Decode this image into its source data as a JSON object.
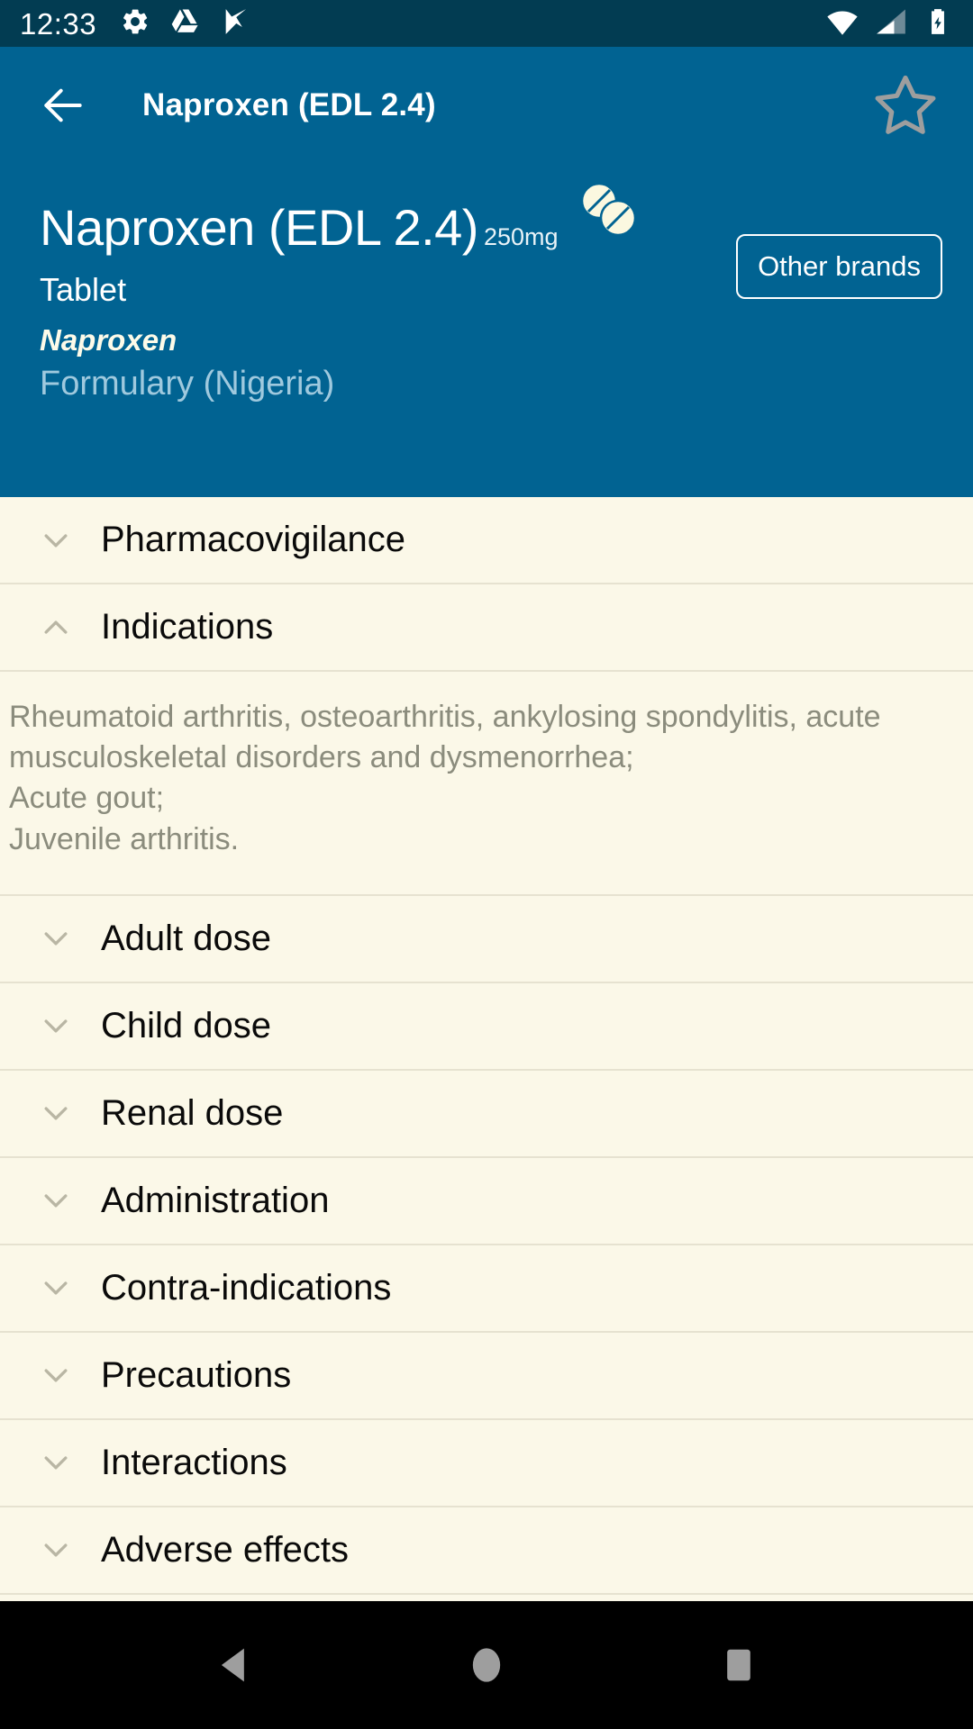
{
  "statusbar": {
    "time": "12:33",
    "left_icons": [
      "gear-icon",
      "google-drive-icon",
      "tasks-check-icon"
    ],
    "right_icons": [
      "wifi-icon",
      "cellular-signal-icon",
      "battery-charging-icon"
    ],
    "background_color": "#023c52"
  },
  "appbar": {
    "back_label": "back-arrow",
    "title": "Naproxen (EDL 2.4)",
    "favorite_label": "star-outline",
    "background_color": "#016392",
    "star_color": "#9e9e9e"
  },
  "drug_header": {
    "name": "Naproxen (EDL 2.4)",
    "strength": "250mg",
    "form": "Tablet",
    "generic": "Naproxen",
    "formulary": "Formulary (Nigeria)",
    "other_brands_label": "Other brands",
    "pill_icon": "two-tablets-icon",
    "pill_color": "#fbf8e0"
  },
  "sections": [
    {
      "label": "Pharmacovigilance",
      "expanded": false,
      "chevron": "chevron-down-icon",
      "body": ""
    },
    {
      "label": "Indications",
      "expanded": true,
      "chevron": "chevron-up-icon",
      "body": "Rheumatoid arthritis, osteoarthritis, ankylosing spondylitis, acute musculoskeletal disorders and dysmenorrhea;\nAcute gout;\nJuvenile arthritis."
    },
    {
      "label": "Adult dose",
      "expanded": false,
      "chevron": "chevron-down-icon",
      "body": ""
    },
    {
      "label": "Child dose",
      "expanded": false,
      "chevron": "chevron-down-icon",
      "body": ""
    },
    {
      "label": "Renal dose",
      "expanded": false,
      "chevron": "chevron-down-icon",
      "body": ""
    },
    {
      "label": "Administration",
      "expanded": false,
      "chevron": "chevron-down-icon",
      "body": ""
    },
    {
      "label": "Contra-indications",
      "expanded": false,
      "chevron": "chevron-down-icon",
      "body": ""
    },
    {
      "label": "Precautions",
      "expanded": false,
      "chevron": "chevron-down-icon",
      "body": ""
    },
    {
      "label": "Interactions",
      "expanded": false,
      "chevron": "chevron-down-icon",
      "body": ""
    },
    {
      "label": "Adverse effects",
      "expanded": false,
      "chevron": "chevron-down-icon",
      "body": ""
    }
  ],
  "navbar": {
    "back": "nav-back-triangle-icon",
    "home": "nav-home-circle-icon",
    "recents": "nav-recents-square-icon",
    "icon_color": "#9e9e9e"
  },
  "colors": {
    "status_bar": "#023c52",
    "header_blue": "#016392",
    "content_bg": "#fbf8e8",
    "divider": "#e6e2d0",
    "body_text": "#8b8c7d",
    "title_text": "#0a0a0a"
  }
}
